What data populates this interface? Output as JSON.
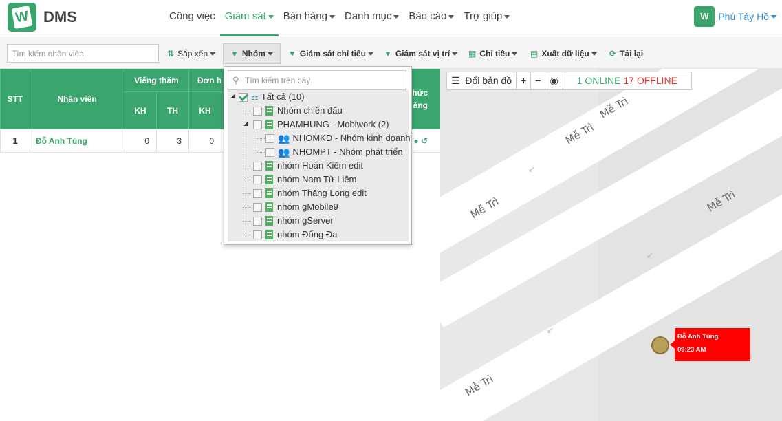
{
  "app": {
    "logo_letter": "W",
    "name": "DMS"
  },
  "nav": {
    "items": [
      {
        "label": "Công việc",
        "dropdown": false
      },
      {
        "label": "Giám sát",
        "dropdown": true,
        "active": true
      },
      {
        "label": "Bán hàng",
        "dropdown": true
      },
      {
        "label": "Danh mục",
        "dropdown": true
      },
      {
        "label": "Báo cáo",
        "dropdown": true
      },
      {
        "label": "Trợ giúp",
        "dropdown": true
      }
    ],
    "user": "Phú Tây Hồ"
  },
  "toolbar": {
    "search_placeholder": "Tìm kiếm nhân viên",
    "sort": "Sắp xếp",
    "group": "Nhóm",
    "kpi_monitor": "Giám sát chỉ tiêu",
    "location_monitor": "Giám sát vị trí",
    "kpi": "Chỉ tiêu",
    "export": "Xuất dữ liệu",
    "reload": "Tải lại"
  },
  "table": {
    "headers": {
      "stt": "STT",
      "staff": "Nhân viên",
      "visit": "Viếng thăm",
      "order": "Đơn h",
      "form": "hức",
      "form2": "ăng",
      "kh": "KH",
      "th": "TH",
      "kh2": "KH"
    },
    "rows": [
      {
        "stt": "1",
        "name": "Đỗ Anh Tùng",
        "visit_kh": "0",
        "visit_th": "3",
        "order_kh": "0"
      }
    ]
  },
  "tree": {
    "search_placeholder": "Tìm kiếm trên cây",
    "root": "Tất cả (10)",
    "nodes": [
      "Nhóm chiến đấu",
      "PHAMHUNG - Mobiwork (2)",
      "NHOMKD - Nhóm kinh doanh",
      "NHOMPT - Nhóm phát triển",
      "nhóm Hoàn Kiếm edit",
      "nhóm Nam Từ Liêm",
      "nhóm Thăng Long edit",
      "nhóm gMobile9",
      "nhóm gServer",
      "nhóm Đống Đa"
    ]
  },
  "map": {
    "change_map": "Đổi bản đồ",
    "online": "1 ONLINE",
    "offline": "17 OFFLINE",
    "street_labels": [
      "Mễ Trì",
      "Mễ Trì",
      "Mễ Trì",
      "Mễ Trì",
      "Mễ Trì"
    ],
    "callout_name": "Đỗ Anh Tùng",
    "callout_time": "09:23 AM"
  }
}
